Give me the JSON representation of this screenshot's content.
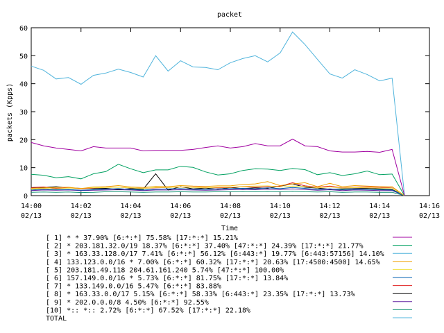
{
  "chart_data": {
    "type": "line",
    "title": "packet",
    "xlabel": "Time",
    "ylabel": "packets (Kpps)",
    "ylim": [
      0,
      60
    ],
    "yticks": [
      0,
      10,
      20,
      30,
      40,
      50,
      60
    ],
    "xlim": [
      0,
      16
    ],
    "xticks": [
      {
        "t": 0,
        "time": "14:00",
        "date": "02/13"
      },
      {
        "t": 2,
        "time": "14:02",
        "date": "02/13"
      },
      {
        "t": 4,
        "time": "14:04",
        "date": "02/13"
      },
      {
        "t": 6,
        "time": "14:06",
        "date": "02/13"
      },
      {
        "t": 8,
        "time": "14:08",
        "date": "02/13"
      },
      {
        "t": 10,
        "time": "14:10",
        "date": "02/13"
      },
      {
        "t": 12,
        "time": "14:12",
        "date": "02/13"
      },
      {
        "t": 14,
        "time": "14:14",
        "date": "02/13"
      },
      {
        "t": 16,
        "time": "14:16",
        "date": "02/13"
      }
    ],
    "x": [
      0,
      0.5,
      1,
      1.5,
      2,
      2.5,
      3,
      3.5,
      4,
      4.5,
      5,
      5.5,
      6,
      6.5,
      7,
      7.5,
      8,
      8.5,
      9,
      9.5,
      10,
      10.5,
      11,
      11.5,
      12,
      12.5,
      13,
      13.5,
      14,
      14.5,
      15
    ],
    "series": [
      {
        "name": "[ 1] * * 37.90%  [6:*:*] 75.58% [17:*:*] 15.21%",
        "color": "#a000a0",
        "values": [
          19,
          17.8,
          17,
          16.5,
          16,
          17.5,
          17,
          17,
          17,
          16,
          16.2,
          16.2,
          16.2,
          16.5,
          17.2,
          17.8,
          17,
          17.5,
          18.6,
          17.8,
          17.8,
          20.2,
          17.8,
          17.5,
          16,
          15.6,
          15.6,
          15.8,
          15.5,
          16.5,
          0
        ]
      },
      {
        "name": "[ 2] * 203.181.32.0/19 18.37%  [6:*:*] 37.40% [47:*:*] 24.39% [17:*:*] 21.77%",
        "color": "#00a060",
        "values": [
          7.6,
          7.3,
          6.4,
          6.8,
          6,
          7.8,
          8.6,
          11.2,
          9.6,
          8.2,
          9.2,
          9.2,
          10.5,
          10.1,
          8.5,
          7.4,
          7.8,
          9,
          9.6,
          9.5,
          9,
          9.7,
          9.3,
          7.5,
          8.2,
          7.2,
          7.8,
          8.8,
          7.5,
          7.7,
          0
        ]
      },
      {
        "name": "[ 3] * 163.33.128.0/17 7.41%  [6:*:*] 56.12% [6:443:*] 19.77% [6:443:57156] 14.10%",
        "color": "#50b4dc",
        "values": [
          46.3,
          44.8,
          41.7,
          42.2,
          39.8,
          43,
          43.8,
          45.2,
          44,
          42.4,
          50,
          44.5,
          48.2,
          46,
          45.8,
          45,
          47.5,
          49,
          50,
          47.8,
          51,
          58.5,
          54,
          48.7,
          43.5,
          42,
          45,
          43.3,
          41,
          42,
          0
        ]
      },
      {
        "name": "[ 4] 133.123.0.0/16 * 7.00%  [6:*:*] 60.32% [17:*:*] 20.63% [17:4500:4500] 14.65%",
        "color": "#f0a000",
        "values": [
          2.6,
          2.8,
          2.9,
          3.0,
          2.5,
          3.1,
          3.2,
          3.6,
          3.1,
          2.9,
          3.3,
          3.2,
          3.6,
          3.4,
          3.3,
          3.5,
          3.5,
          4.0,
          4.2,
          5.0,
          3.6,
          4.2,
          4.6,
          3.2,
          4.4,
          3.2,
          3.6,
          3.4,
          3.2,
          3.2,
          0
        ]
      },
      {
        "name": "[ 5] 203.181.49.118 204.61.161.240 5.74%  [47:*:*] 100.00%",
        "color": "#f0e040",
        "values": [
          2.3,
          2.6,
          2.4,
          2.7,
          2.6,
          2.8,
          2.9,
          3.0,
          2.8,
          2.6,
          2.9,
          2.9,
          3.1,
          2.9,
          2.8,
          3.0,
          3.0,
          3.3,
          3.4,
          3.5,
          3.1,
          3.4,
          3.3,
          2.8,
          3.1,
          2.7,
          2.9,
          2.8,
          2.7,
          2.7,
          0
        ]
      },
      {
        "name": "[ 6] 157.149.0.0/16 * 5.73%  [6:*:*] 81.75% [17:*:*] 13.84%",
        "color": "#0060b0",
        "values": [
          2.0,
          2.3,
          2.1,
          2.2,
          1.9,
          2.1,
          2.3,
          2.5,
          2.2,
          2.0,
          2.3,
          2.4,
          2.5,
          2.3,
          2.2,
          2.4,
          2.5,
          2.6,
          2.4,
          2.8,
          2.5,
          2.9,
          2.6,
          2.2,
          2.4,
          2.1,
          2.3,
          2.2,
          2.1,
          2.0,
          0
        ]
      },
      {
        "name": "[ 7] * 133.149.0.0/16 5.47%  [6:*:*] 83.88%",
        "color": "#e02020",
        "values": [
          2.9,
          3.1,
          2.6,
          2.8,
          2.4,
          2.7,
          3.0,
          3.0,
          2.8,
          2.6,
          2.8,
          2.9,
          3.1,
          3.0,
          2.9,
          2.8,
          2.9,
          3.2,
          3.0,
          3.2,
          3.4,
          4.6,
          3.5,
          3.0,
          3.4,
          2.8,
          3.0,
          3.1,
          3.0,
          2.8,
          0
        ]
      },
      {
        "name": "[ 8] * 163.33.0.0/17 5.15%  [6:*:*] 58.33% [6:443:*] 23.35% [17:*:*] 13.73%",
        "color": "#000000",
        "values": [
          2.7,
          2.9,
          3.2,
          2.8,
          2.6,
          2.5,
          2.6,
          2.2,
          2.5,
          2.3,
          7.8,
          2.0,
          3.2,
          2.4,
          2.7,
          2.3,
          2.9,
          2.5,
          2.8,
          2.6,
          3.4,
          4.2,
          3.0,
          2.7,
          2.3,
          2.4,
          2.5,
          2.6,
          2.4,
          2.2,
          0
        ]
      },
      {
        "name": "[ 9] * 202.0.0.0/8 4.50%  [6:*:*] 92.55%",
        "color": "#6020a0",
        "values": [
          1.8,
          2.0,
          1.9,
          2.0,
          1.8,
          1.9,
          2.0,
          2.1,
          2.0,
          1.8,
          2.0,
          2.0,
          2.1,
          2.0,
          1.9,
          2.0,
          2.1,
          2.2,
          2.1,
          2.3,
          2.2,
          2.4,
          2.2,
          1.9,
          2.1,
          1.8,
          2.0,
          1.9,
          1.8,
          1.8,
          0
        ]
      },
      {
        "name": "[10] *:: *:: 2.72%  [6:*:*] 67.52% [17:*:*] 22.18%",
        "color": "#109070",
        "values": [
          1.2,
          1.3,
          1.2,
          1.3,
          1.1,
          1.2,
          1.4,
          1.4,
          1.3,
          1.2,
          1.3,
          1.3,
          1.4,
          1.3,
          1.3,
          1.4,
          1.4,
          1.5,
          1.4,
          1.5,
          1.4,
          1.6,
          1.4,
          1.3,
          1.4,
          1.2,
          1.3,
          1.3,
          1.2,
          1.2,
          0
        ]
      },
      {
        "name": "TOTAL",
        "color": "#50b4dc",
        "values": []
      }
    ],
    "grid": false,
    "legend": "bottom"
  }
}
